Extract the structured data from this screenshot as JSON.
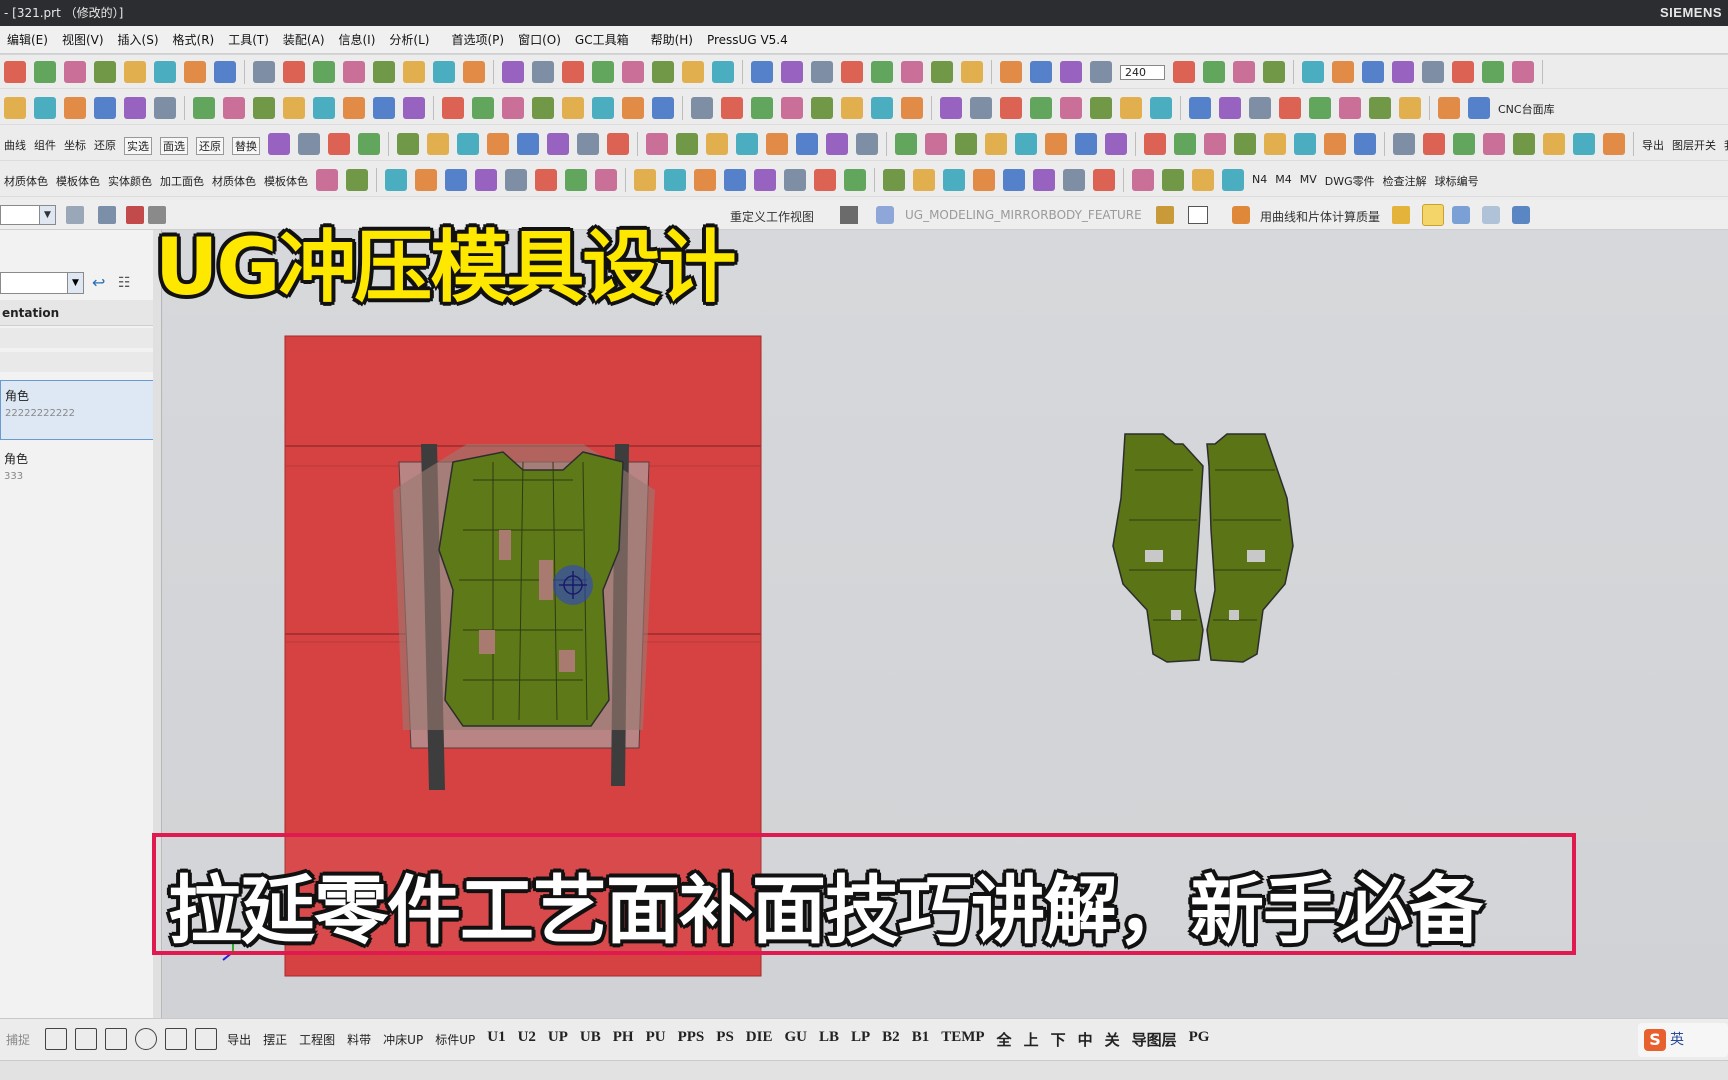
{
  "window": {
    "title": "- [321.prt （修改的）]",
    "brand": "SIEMENS"
  },
  "menu": [
    "编辑(E)",
    "视图(V)",
    "插入(S)",
    "格式(R)",
    "工具(T)",
    "装配(A)",
    "信息(I)",
    "分析(L)",
    "首选项(P)",
    "窗口(O)",
    "GC工具箱",
    "帮助(H)",
    "PressUG V5.4"
  ],
  "toolbar": {
    "zoom_value": "240",
    "row3_labels": [
      "曲线",
      "组件",
      "坐标",
      "还原"
    ],
    "row3_badges": [
      "实选",
      "面选",
      "还原",
      "替换"
    ],
    "row3_right": [
      "导出",
      "图层开关",
      "我的标准件"
    ],
    "row4_labels": [
      "材质体色",
      "模板体色",
      "实体颜色",
      "加工面色",
      "材质体色",
      "模板体色"
    ],
    "row4_right": [
      "N4",
      "M4",
      "MV",
      "DWG零件",
      "检查注解",
      "球标编号"
    ],
    "row2_right": "CNC台面库",
    "row1_right_text": "用曲线和片体计算质量",
    "row1_feature": "UG_MODELING_MIRRORBODY_FEATURE",
    "row1_view": "重定义工作视图"
  },
  "panel": {
    "header": "entation",
    "items": [
      {
        "label": "角色",
        "sub": "22222222222",
        "active": true
      },
      {
        "label": "角色",
        "sub": "333",
        "active": false
      }
    ]
  },
  "statusbar": {
    "left_text": "捕捉",
    "labels": [
      "导出",
      "摆正",
      "工程图",
      "料带",
      "冲床UP",
      "标件UP"
    ],
    "codes": [
      "U1",
      "U2",
      "UP",
      "UB",
      "PH",
      "PU",
      "PPS",
      "PS",
      "DIE",
      "GU",
      "LB",
      "LP",
      "B2",
      "B1"
    ],
    "misc": [
      "TEMP",
      "全",
      "上",
      "下",
      "中",
      "关",
      "导图层",
      "PG"
    ],
    "ime_logo": "S",
    "ime_lang": "英"
  },
  "overlay": {
    "title": "UG冲压模具设计",
    "caption": "拉延零件工艺面补面技巧讲解，新手必备"
  },
  "colors": {
    "die_red": "#d64142",
    "part_green": "#5e7a18",
    "title_yellow": "#ffe800",
    "caption_border": "#e01a4f"
  }
}
